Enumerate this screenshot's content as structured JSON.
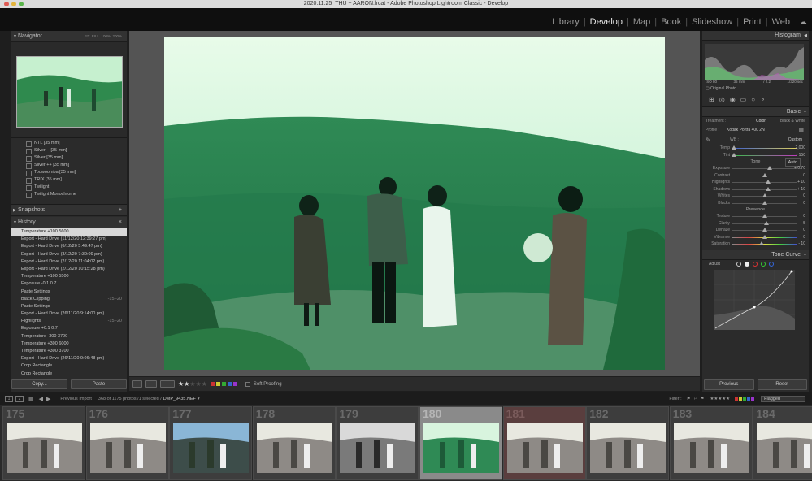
{
  "window": {
    "title": "2020.11.25_THU + AARON.lrcat - Adobe Photoshop Lightroom Classic - Develop"
  },
  "modules": [
    {
      "label": "Library",
      "active": false
    },
    {
      "label": "Develop",
      "active": true
    },
    {
      "label": "Map",
      "active": false
    },
    {
      "label": "Book",
      "active": false
    },
    {
      "label": "Slideshow",
      "active": false
    },
    {
      "label": "Print",
      "active": false
    },
    {
      "label": "Web",
      "active": false
    }
  ],
  "navigator": {
    "title": "Navigator",
    "zoom": [
      "FIT",
      "FILL",
      "100%",
      "200%"
    ]
  },
  "presets": [
    "NTL [35 mm]",
    "Silver -- [35 mm]",
    "Silver [35 mm]",
    "Silver ++ [35 mm]",
    "Toowoomba [35 mm]",
    "TRIX [35 mm]",
    "Twilight",
    "Twilight Monochrome"
  ],
  "snapshots": {
    "title": "Snapshots"
  },
  "history": {
    "title": "History",
    "items": [
      {
        "label": "Temperature  +100  5600",
        "badge": "",
        "selected": true
      },
      {
        "label": "Export - Hard Drive (11/12/20 12:39:27 pm)",
        "badge": ""
      },
      {
        "label": "Export - Hard Drive (6/12/20 5:49:47 pm)",
        "badge": ""
      },
      {
        "label": "Export - Hard Drive (3/12/20 7:39:09 pm)",
        "badge": ""
      },
      {
        "label": "Export - Hard Drive (2/12/20 11:04:02 pm)",
        "badge": ""
      },
      {
        "label": "Export - Hard Drive (2/12/20 10:15:28 pm)",
        "badge": ""
      },
      {
        "label": "Temperature  +100  5500",
        "badge": ""
      },
      {
        "label": "Exposure  -0.1  0.7",
        "badge": ""
      },
      {
        "label": "Paste Settings",
        "badge": ""
      },
      {
        "label": "Black Clipping",
        "badge": "-15   -20"
      },
      {
        "label": "Paste Settings",
        "badge": ""
      },
      {
        "label": "Export - Hard Drive (26/11/20 9:14:00 pm)",
        "badge": ""
      },
      {
        "label": "Highlights",
        "badge": "-15   -20"
      },
      {
        "label": "Exposure  +0.1  0.7",
        "badge": ""
      },
      {
        "label": "Temperature  -300  3700",
        "badge": ""
      },
      {
        "label": "Temperature  +300  6000",
        "badge": ""
      },
      {
        "label": "Temperature  +300  3700",
        "badge": ""
      },
      {
        "label": "Export - Hard Drive (26/11/20 9:06:48 pm)",
        "badge": ""
      },
      {
        "label": "Crop Rectangle",
        "badge": ""
      },
      {
        "label": "Crop Rectangle",
        "badge": ""
      }
    ]
  },
  "left_buttons": {
    "copy": "Copy...",
    "paste": "Paste"
  },
  "toolbar": {
    "soft_proofing": "Soft Proofing",
    "rating": 2
  },
  "histogram": {
    "title": "Histogram",
    "iso": "ISO 80",
    "shutter": "35 mm",
    "aperture": "f / 2.2",
    "exp": "1/320 sec",
    "original": "Original Photo"
  },
  "basic": {
    "title": "Basic",
    "treatment_label": "Treatment :",
    "color": "Color",
    "bw": "Black & White",
    "profile_label": "Profile :",
    "profile": "Kodak Portra 400 2N",
    "wb_label": "WB :",
    "wb": "Custom",
    "tone_label": "Tone",
    "auto": "Auto",
    "presence_label": "Presence",
    "sliders": [
      {
        "label": "Temp",
        "value": "2,000",
        "pos": 0.02
      },
      {
        "label": "Tint",
        "value": "- 150",
        "pos": 0.03
      },
      {
        "label": "Exposure",
        "value": "+ 0.70",
        "pos": 0.57
      },
      {
        "label": "Contrast",
        "value": "0",
        "pos": 0.5
      },
      {
        "label": "Highlights",
        "value": "+ 10",
        "pos": 0.55
      },
      {
        "label": "Shadows",
        "value": "+ 10",
        "pos": 0.55
      },
      {
        "label": "Whites",
        "value": "0",
        "pos": 0.5
      },
      {
        "label": "Blacks",
        "value": "0",
        "pos": 0.5
      },
      {
        "label": "Texture",
        "value": "0",
        "pos": 0.5
      },
      {
        "label": "Clarity",
        "value": "+ 5",
        "pos": 0.52
      },
      {
        "label": "Dehaze",
        "value": "0",
        "pos": 0.5
      },
      {
        "label": "Vibrance",
        "value": "0",
        "pos": 0.5
      },
      {
        "label": "Saturation",
        "value": "- 10",
        "pos": 0.45
      }
    ]
  },
  "tone_curve": {
    "title": "Tone Curve",
    "adjust": "Adjust"
  },
  "right_buttons": {
    "previous": "Previous",
    "reset": "Reset"
  },
  "filmstrip_bar": {
    "source": "Previous Import",
    "count": "368 of 1175 photos /1 selected /",
    "file": "DMP_9435.NEF",
    "filter_label": "Filter :",
    "filter_value": "Flagged"
  },
  "filmstrip": [
    {
      "num": "175",
      "style": "warm"
    },
    {
      "num": "176",
      "style": "warm"
    },
    {
      "num": "177",
      "style": "blue"
    },
    {
      "num": "178",
      "style": "warm"
    },
    {
      "num": "179",
      "style": "bw"
    },
    {
      "num": "180",
      "style": "green",
      "selected": true
    },
    {
      "num": "181",
      "style": "warm",
      "selected2": true
    },
    {
      "num": "182",
      "style": "warm"
    },
    {
      "num": "183",
      "style": "warm"
    },
    {
      "num": "184",
      "style": "warm"
    }
  ]
}
